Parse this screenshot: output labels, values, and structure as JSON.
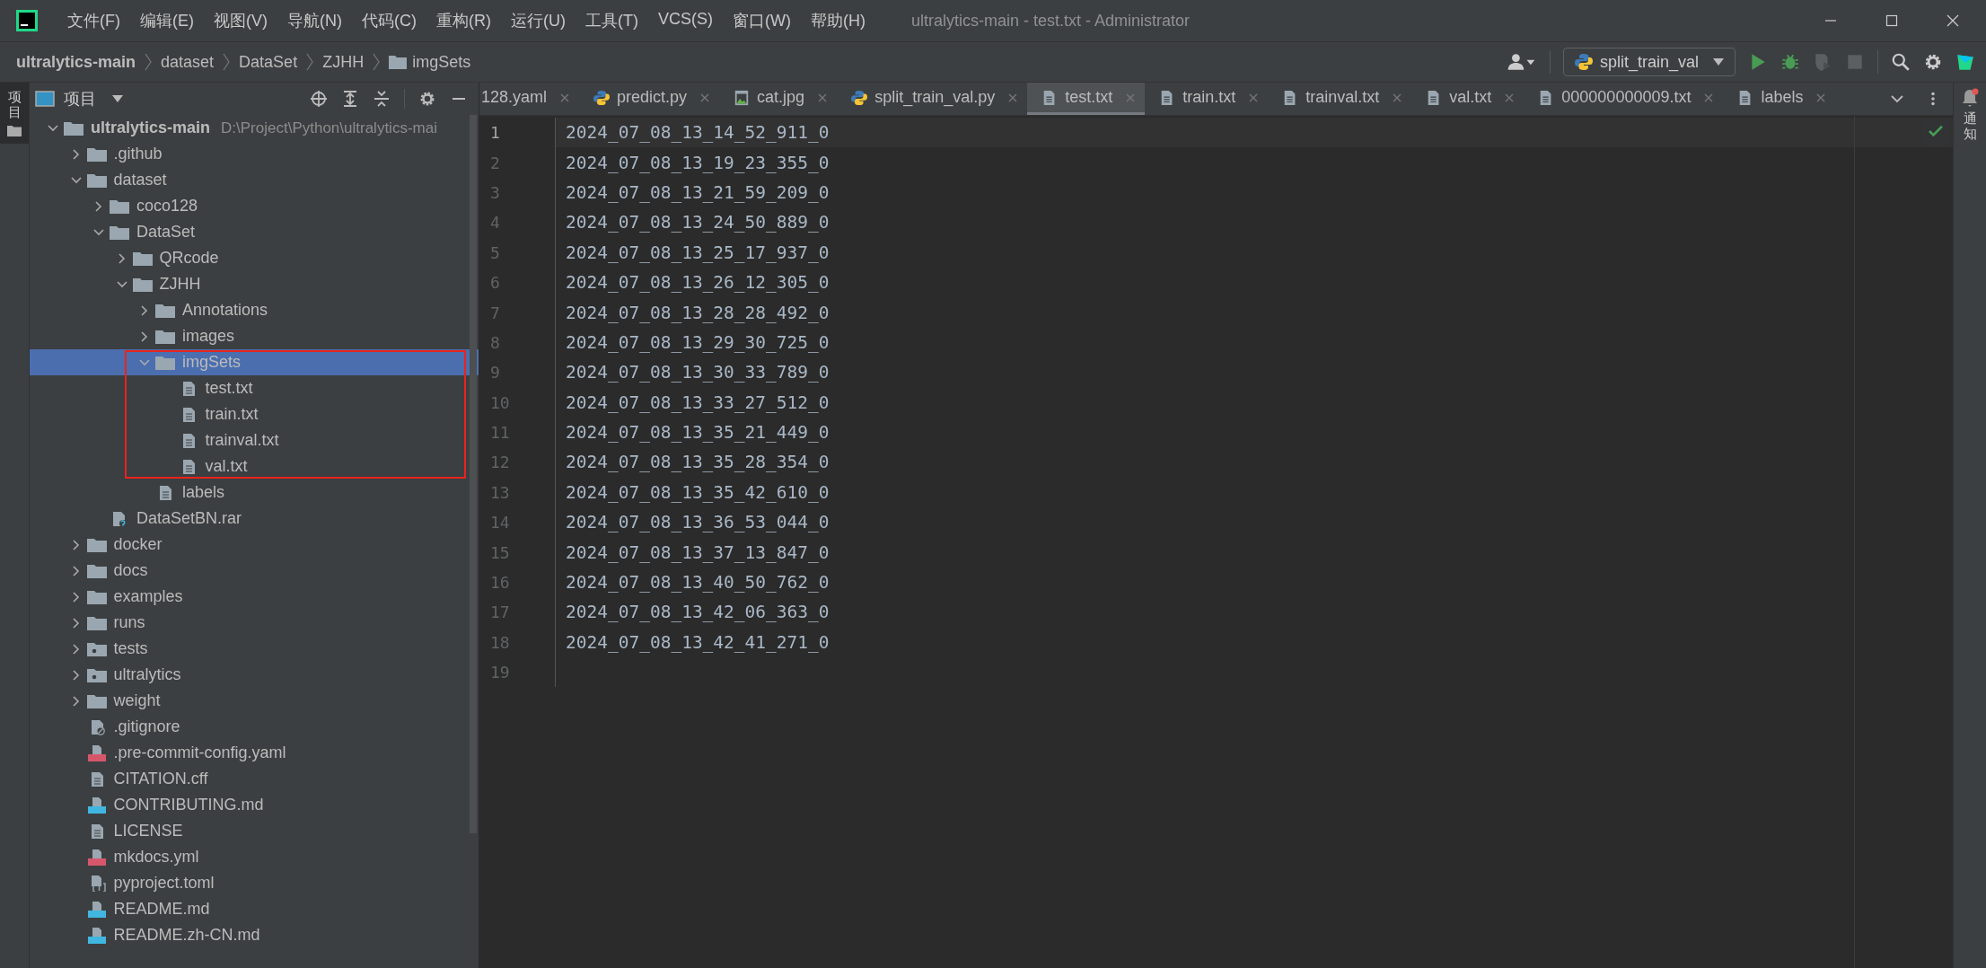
{
  "window": {
    "title": "ultralytics-main - test.txt - Administrator"
  },
  "menu": [
    {
      "label": "文件(F)"
    },
    {
      "label": "编辑(E)"
    },
    {
      "label": "视图(V)"
    },
    {
      "label": "导航(N)"
    },
    {
      "label": "代码(C)"
    },
    {
      "label": "重构(R)"
    },
    {
      "label": "运行(U)"
    },
    {
      "label": "工具(T)"
    },
    {
      "label": "VCS(S)"
    },
    {
      "label": "窗口(W)"
    },
    {
      "label": "帮助(H)"
    }
  ],
  "breadcrumb": [
    {
      "label": "ultralytics-main",
      "kind": "project"
    },
    {
      "label": "dataset",
      "kind": "plain"
    },
    {
      "label": "DataSet",
      "kind": "plain"
    },
    {
      "label": "ZJHH",
      "kind": "plain"
    },
    {
      "label": "imgSets",
      "kind": "folder"
    }
  ],
  "run_config": {
    "label": "split_train_val"
  },
  "toolbar": [
    {
      "kind": "run",
      "disabled": false
    },
    {
      "kind": "debug",
      "disabled": false
    },
    {
      "kind": "coverage",
      "disabled": true
    },
    {
      "kind": "stop",
      "disabled": true
    }
  ],
  "left_stripe": {
    "label": "项目",
    "selected": true
  },
  "right_stripe": {
    "label": "通知",
    "unread": true
  },
  "project": {
    "title": "项目",
    "tree": [
      {
        "name": "ultralytics-main",
        "path": "D:\\Project\\Python\\ultralytics-mai",
        "kind": "folder",
        "expanded": true,
        "selected": false,
        "framed": false,
        "children": [
          {
            "name": ".github",
            "kind": "folder",
            "expanded": false,
            "selected": false,
            "framed": false
          },
          {
            "name": "dataset",
            "kind": "folder",
            "expanded": true,
            "selected": false,
            "framed": false,
            "children": [
              {
                "name": "coco128",
                "kind": "folder",
                "expanded": false,
                "selected": false,
                "framed": false
              },
              {
                "name": "DataSet",
                "kind": "folder",
                "expanded": true,
                "selected": false,
                "framed": false,
                "children": [
                  {
                    "name": "QRcode",
                    "kind": "folder",
                    "expanded": false,
                    "selected": false,
                    "framed": false
                  },
                  {
                    "name": "ZJHH",
                    "kind": "folder",
                    "expanded": true,
                    "selected": false,
                    "framed": false,
                    "children": [
                      {
                        "name": "Annotations",
                        "kind": "folder",
                        "expanded": false,
                        "selected": false,
                        "framed": false
                      },
                      {
                        "name": "images",
                        "kind": "folder",
                        "expanded": false,
                        "selected": false,
                        "framed": false
                      },
                      {
                        "name": "imgSets",
                        "kind": "folder",
                        "expanded": true,
                        "selected": true,
                        "framed": true,
                        "children": [
                          {
                            "name": "test.txt",
                            "kind": "text",
                            "selected": false,
                            "framed": false
                          },
                          {
                            "name": "train.txt",
                            "kind": "text",
                            "selected": false,
                            "framed": false
                          },
                          {
                            "name": "trainval.txt",
                            "kind": "text",
                            "selected": false,
                            "framed": false
                          },
                          {
                            "name": "val.txt",
                            "kind": "text",
                            "selected": false,
                            "framed": false
                          }
                        ]
                      },
                      {
                        "name": "labels",
                        "kind": "text",
                        "selected": false,
                        "framed": false
                      }
                    ]
                  }
                ]
              },
              {
                "name": "DataSetBN.rar",
                "kind": "archive",
                "selected": false,
                "framed": false
              }
            ]
          },
          {
            "name": "docker",
            "kind": "folder",
            "expanded": false,
            "selected": false,
            "framed": false
          },
          {
            "name": "docs",
            "kind": "folder",
            "expanded": false,
            "selected": false,
            "framed": false
          },
          {
            "name": "examples",
            "kind": "folder",
            "expanded": false,
            "selected": false,
            "framed": false
          },
          {
            "name": "runs",
            "kind": "folder",
            "expanded": false,
            "selected": false,
            "framed": false
          },
          {
            "name": "tests",
            "kind": "package",
            "expanded": false,
            "selected": false,
            "framed": false
          },
          {
            "name": "ultralytics",
            "kind": "package",
            "expanded": false,
            "selected": false,
            "framed": false
          },
          {
            "name": "weight",
            "kind": "folder",
            "expanded": false,
            "selected": false,
            "framed": false
          },
          {
            "name": ".gitignore",
            "kind": "ignore",
            "selected": false,
            "framed": false
          },
          {
            "name": ".pre-commit-config.yaml",
            "kind": "yaml",
            "selected": false,
            "framed": false
          },
          {
            "name": "CITATION.cff",
            "kind": "text",
            "selected": false,
            "framed": false
          },
          {
            "name": "CONTRIBUTING.md",
            "kind": "md",
            "selected": false,
            "framed": false
          },
          {
            "name": "LICENSE",
            "kind": "text",
            "selected": false,
            "framed": false
          },
          {
            "name": "mkdocs.yml",
            "kind": "yaml",
            "selected": false,
            "framed": false
          },
          {
            "name": "pyproject.toml",
            "kind": "toml",
            "selected": false,
            "framed": false
          },
          {
            "name": "README.md",
            "kind": "md",
            "selected": false,
            "framed": false
          },
          {
            "name": "README.zh-CN.md",
            "kind": "md",
            "selected": false,
            "framed": false
          }
        ]
      }
    ]
  },
  "tabs": [
    {
      "label": "128.yaml",
      "selected": false
    },
    {
      "label": "predict.py",
      "kind": "python",
      "selected": false
    },
    {
      "label": "cat.jpg",
      "kind": "image",
      "selected": false
    },
    {
      "label": "split_train_val.py",
      "kind": "python",
      "selected": false
    },
    {
      "label": "test.txt",
      "kind": "text",
      "selected": true
    },
    {
      "label": "train.txt",
      "kind": "text",
      "selected": false
    },
    {
      "label": "trainval.txt",
      "kind": "text",
      "selected": false
    },
    {
      "label": "val.txt",
      "kind": "text",
      "selected": false
    },
    {
      "label": "000000000009.txt",
      "kind": "text",
      "selected": false
    },
    {
      "label": "labels",
      "kind": "text",
      "selected": false
    }
  ],
  "editor": {
    "inspection_ok": true,
    "lines": [
      {
        "number": "1",
        "text": "2024_07_08_13_14_52_911_0",
        "current": true
      },
      {
        "number": "2",
        "text": "2024_07_08_13_19_23_355_0",
        "current": false
      },
      {
        "number": "3",
        "text": "2024_07_08_13_21_59_209_0",
        "current": false
      },
      {
        "number": "4",
        "text": "2024_07_08_13_24_50_889_0",
        "current": false
      },
      {
        "number": "5",
        "text": "2024_07_08_13_25_17_937_0",
        "current": false
      },
      {
        "number": "6",
        "text": "2024_07_08_13_26_12_305_0",
        "current": false
      },
      {
        "number": "7",
        "text": "2024_07_08_13_28_28_492_0",
        "current": false
      },
      {
        "number": "8",
        "text": "2024_07_08_13_29_30_725_0",
        "current": false
      },
      {
        "number": "9",
        "text": "2024_07_08_13_30_33_789_0",
        "current": false
      },
      {
        "number": "10",
        "text": "2024_07_08_13_33_27_512_0",
        "current": false
      },
      {
        "number": "11",
        "text": "2024_07_08_13_35_21_449_0",
        "current": false
      },
      {
        "number": "12",
        "text": "2024_07_08_13_35_28_354_0",
        "current": false
      },
      {
        "number": "13",
        "text": "2024_07_08_13_35_42_610_0",
        "current": false
      },
      {
        "number": "14",
        "text": "2024_07_08_13_36_53_044_0",
        "current": false
      },
      {
        "number": "15",
        "text": "2024_07_08_13_37_13_847_0",
        "current": false
      },
      {
        "number": "16",
        "text": "2024_07_08_13_40_50_762_0",
        "current": false
      },
      {
        "number": "17",
        "text": "2024_07_08_13_42_06_363_0",
        "current": false
      },
      {
        "number": "18",
        "text": "2024_07_08_13_42_41_271_0",
        "current": false
      },
      {
        "number": "19",
        "current": false
      }
    ]
  }
}
